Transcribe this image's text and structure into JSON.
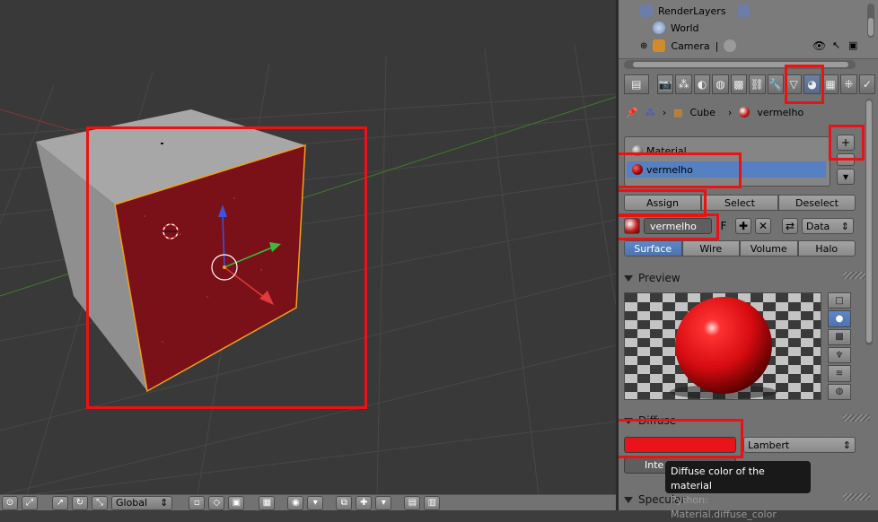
{
  "viewport": {
    "header": {
      "orientation": "Global"
    },
    "grid_color": "#474747",
    "cube_top_color": "#a7a7a7",
    "cube_left_color": "#8f8f8f",
    "face_color": "#7a1018",
    "face_edge_color": "#f0a020"
  },
  "outliner": {
    "items": [
      {
        "label": "RenderLayers",
        "icon": "render-layers-icon"
      },
      {
        "label": "World",
        "icon": "world-icon"
      },
      {
        "label": "Camera",
        "icon": "camera-icon"
      }
    ]
  },
  "properties": {
    "breadcrumb": {
      "object": "Cube",
      "material": "vermelho"
    },
    "material_slots": [
      {
        "label": "Material",
        "color": "#8a8a8a"
      },
      {
        "label": "vermelho",
        "color": "#9b0a0a",
        "active": true
      }
    ],
    "slot_buttons": {
      "assign": "Assign",
      "select": "Select",
      "deselect": "Deselect"
    },
    "material_field": {
      "name": "vermelho",
      "fake_user": "F",
      "link": "Data"
    },
    "type_tabs": [
      "Surface",
      "Wire",
      "Volume",
      "Halo"
    ],
    "preview": {
      "title": "Preview"
    },
    "diffuse": {
      "title": "Diffuse",
      "color": "#e8141a",
      "shader": "Lambert",
      "intensity_label": "Inte"
    },
    "specular": {
      "title": "Specular"
    },
    "tooltip": {
      "title": "Diffuse color of the material",
      "python": "Python: Material.diffuse_color"
    }
  },
  "accent_color": "#5680c2",
  "highlight_color": "#ee1111"
}
